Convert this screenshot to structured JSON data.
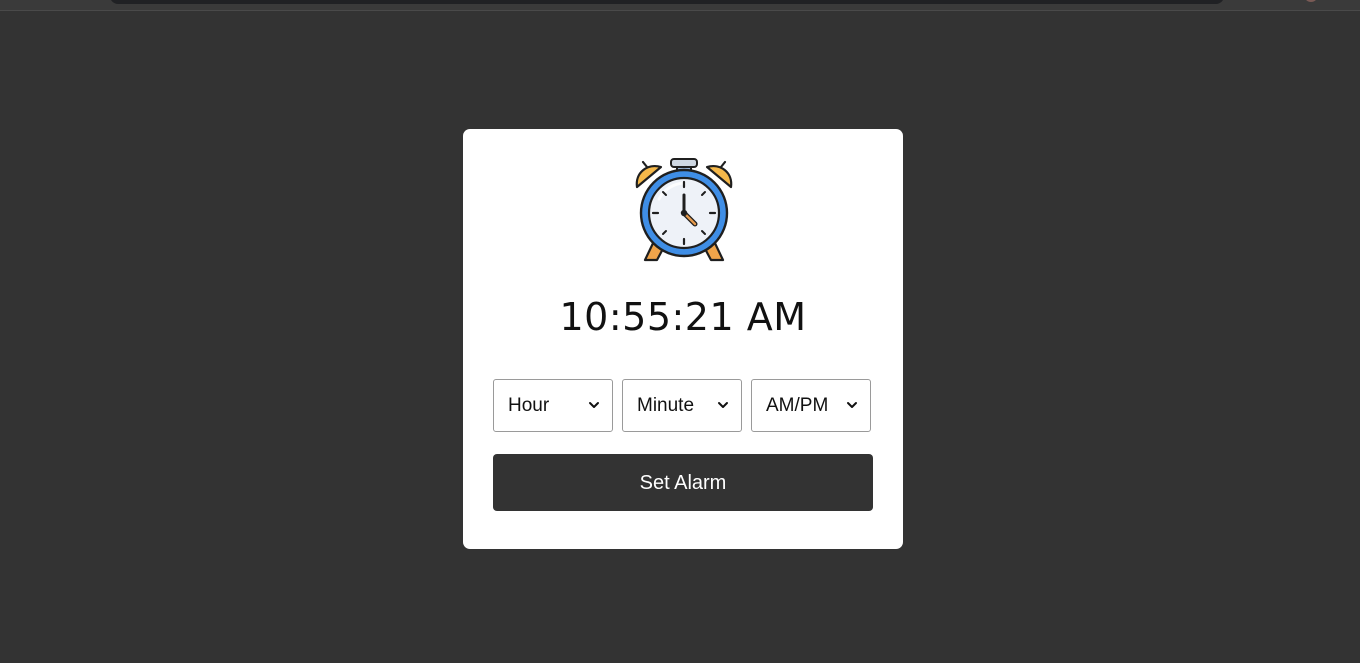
{
  "clock": {
    "current_time": "10:55:21 AM",
    "icon": "alarm-clock-icon"
  },
  "selects": {
    "hour": {
      "selected": "Hour"
    },
    "minute": {
      "selected": "Minute"
    },
    "ampm": {
      "selected": "AM/PM"
    }
  },
  "actions": {
    "set_alarm_label": "Set Alarm"
  },
  "colors": {
    "page_background": "#333333",
    "card_background": "#ffffff",
    "button_background": "#333333",
    "clock_blue": "#3f8ee6",
    "bell_orange": "#f5b84a"
  }
}
